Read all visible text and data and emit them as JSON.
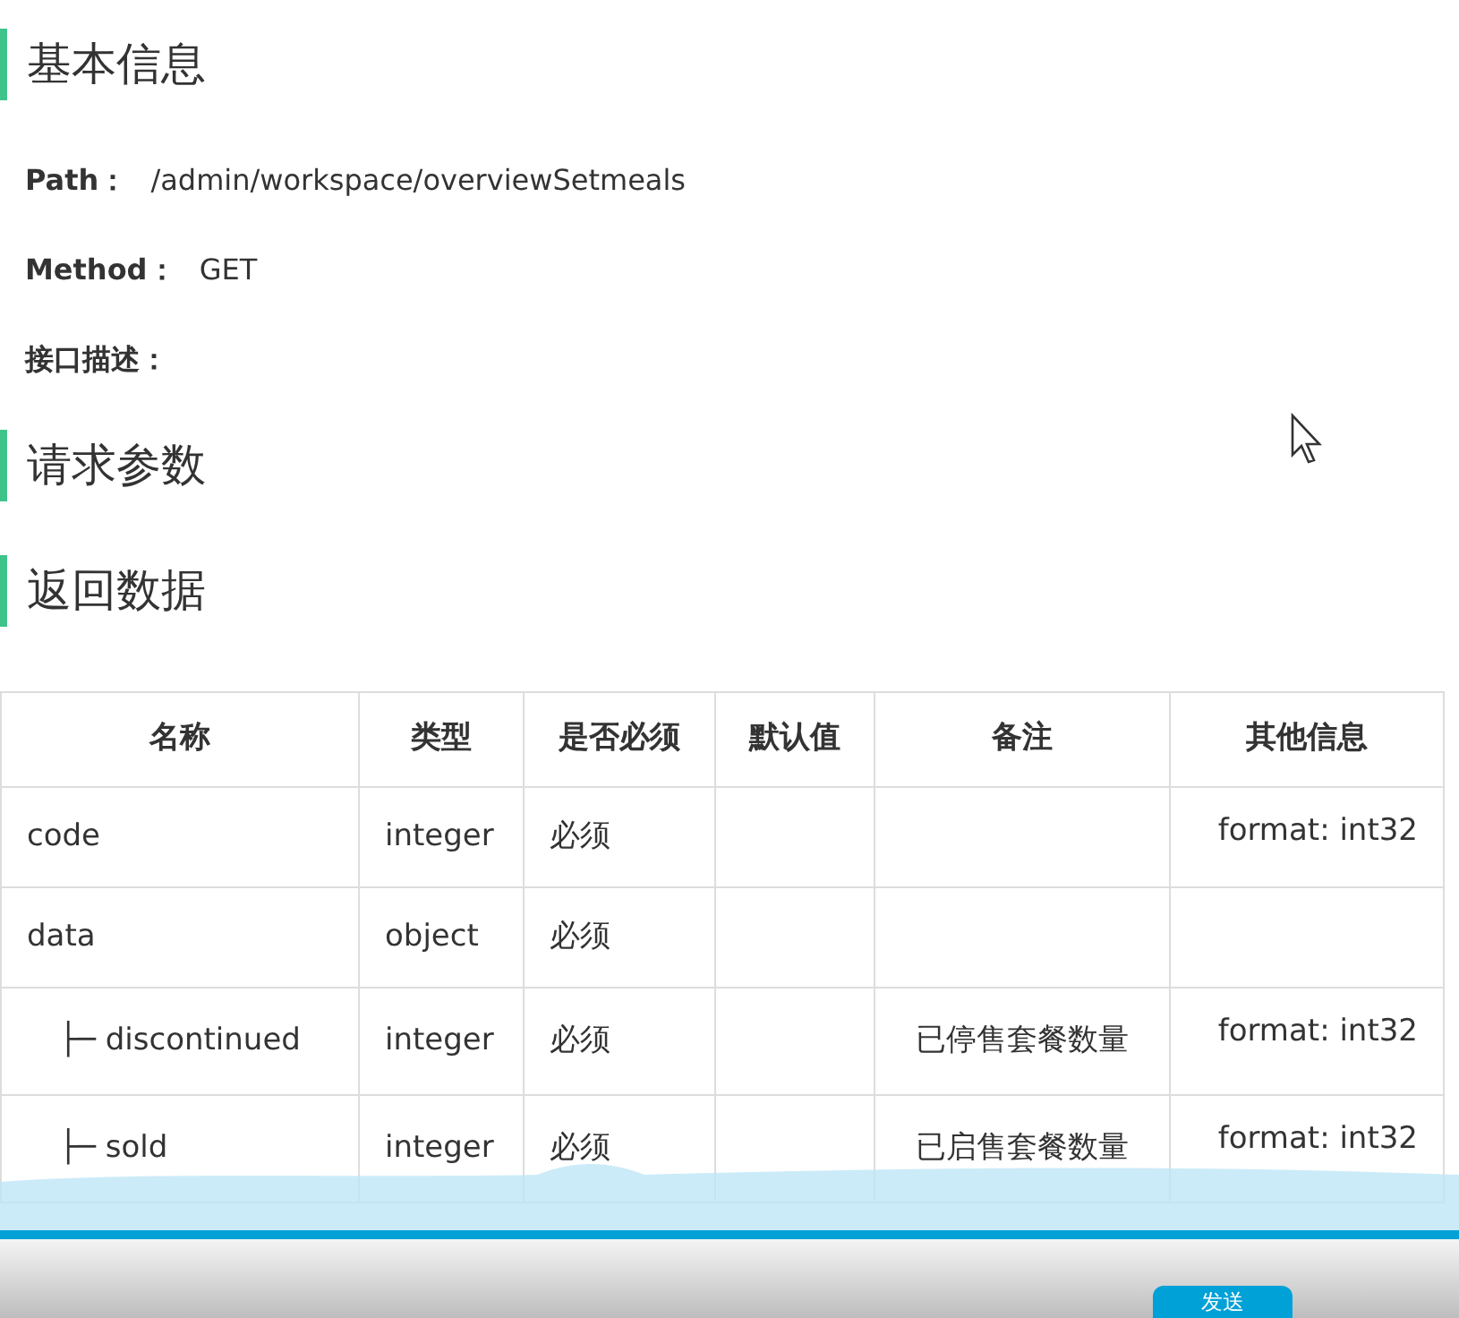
{
  "sections": [
    {
      "title": "基本信息",
      "fields": [
        {
          "label": "Path：",
          "value": "/admin/workspace/overviewSetmeals"
        },
        {
          "label": "Method：",
          "value": "GET"
        },
        {
          "label": "接口描述："
        }
      ]
    },
    {
      "title": "请求参数"
    },
    {
      "title": "返回数据"
    }
  ],
  "table": {
    "columns": [
      "名称",
      "类型",
      "是否必须",
      "默认值",
      "备注",
      "其他信息"
    ],
    "rows": [
      {
        "name": "code",
        "type": "integer",
        "required": "必须",
        "other": "format: int32"
      },
      {
        "name": "data",
        "type": "object",
        "required": "必须",
        "children": [
          {
            "name": "├─ discontinued",
            "type": "integer",
            "required": "必须",
            "note": "已停售套餐数量",
            "other": "format: int32"
          },
          {
            "name": "├─ sold",
            "type": "integer",
            "required": "必须",
            "note": "已启售套餐数量",
            "other": "format: int32"
          }
        ]
      }
    ]
  },
  "player": {
    "progress": {
      "level": 1
    },
    "send_button": "发送"
  }
}
